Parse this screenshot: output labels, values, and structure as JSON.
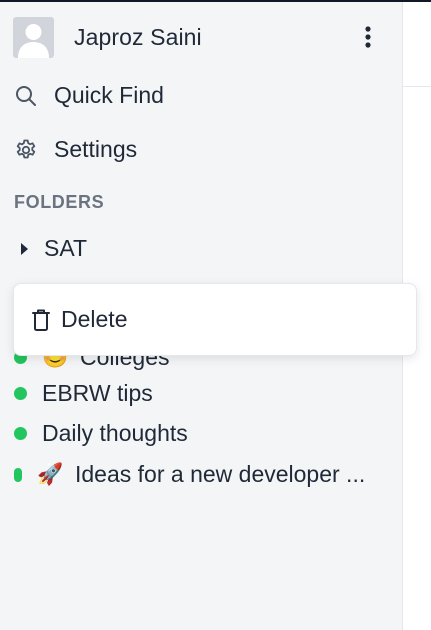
{
  "user": {
    "name": "Japroz Saini",
    "avatar_icon": "default-avatar-icon",
    "menu_icon": "kebab-menu-icon"
  },
  "nav": {
    "quick_find": {
      "label": "Quick Find",
      "icon": "search-icon"
    },
    "settings": {
      "label": "Settings",
      "icon": "gear-icon"
    }
  },
  "folders": {
    "heading": "FOLDERS",
    "items": [
      {
        "label": "SAT",
        "icon": "caret-right-icon"
      }
    ]
  },
  "notes": [
    {
      "label": "Colleges",
      "emoji": "😊",
      "dot_color": "#22c55e"
    },
    {
      "label": "EBRW tips",
      "emoji": "",
      "dot_color": "#22c55e"
    },
    {
      "label": "Daily thoughts",
      "emoji": "",
      "dot_color": "#22c55e"
    },
    {
      "label": "Ideas for a new developer ...",
      "emoji": "🚀",
      "dot_color": "#22c55e"
    }
  ],
  "context_menu": {
    "delete_label": "Delete",
    "delete_icon": "trash-icon"
  },
  "colors": {
    "sidebar_bg": "#f4f5f7",
    "accent_dot": "#22c55e",
    "text": "#1f2937",
    "muted": "#6b7280"
  }
}
